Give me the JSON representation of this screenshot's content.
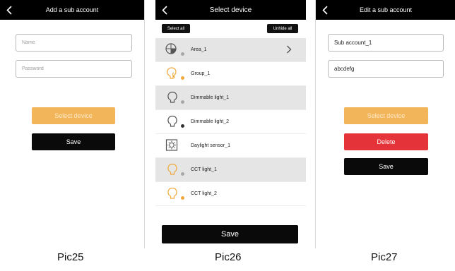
{
  "pic25": {
    "title": "Add a sub account",
    "name_placeholder": "Name",
    "password_placeholder": "Password",
    "select_device_label": "Select device",
    "save_label": "Save",
    "caption": "Pic25"
  },
  "pic26": {
    "title": "Select device",
    "select_all_label": "Select all",
    "unhide_all_label": "Unhide all",
    "items": [
      {
        "label": "Area_1"
      },
      {
        "label": "Group_1"
      },
      {
        "label": "Dimmable light_1"
      },
      {
        "label": "Dimmable light_2"
      },
      {
        "label": "Daylight sensor_1"
      },
      {
        "label": "CCT light_1"
      },
      {
        "label": "CCT light_2"
      }
    ],
    "save_label": "Save",
    "caption": "Pic26"
  },
  "pic27": {
    "title": "Edit a sub account",
    "name_value": "Sub account_1",
    "password_value": "abcdefg",
    "select_device_label": "Select device",
    "delete_label": "Delete",
    "save_label": "Save",
    "caption": "Pic27"
  },
  "colors": {
    "header": "#000000",
    "accent_orange": "#f2b55a",
    "delete_red": "#e5333a",
    "selected_row": "#e5e5e5",
    "dot_orange": "#f2a93b",
    "dot_gray": "#a8a8a8"
  },
  "icons": {
    "back": "chevron-left-icon",
    "area": "area-icon",
    "group": "group-bulb-icon",
    "bulb": "bulb-icon",
    "sensor": "daylight-sensor-icon",
    "more": "chevron-right-icon"
  }
}
